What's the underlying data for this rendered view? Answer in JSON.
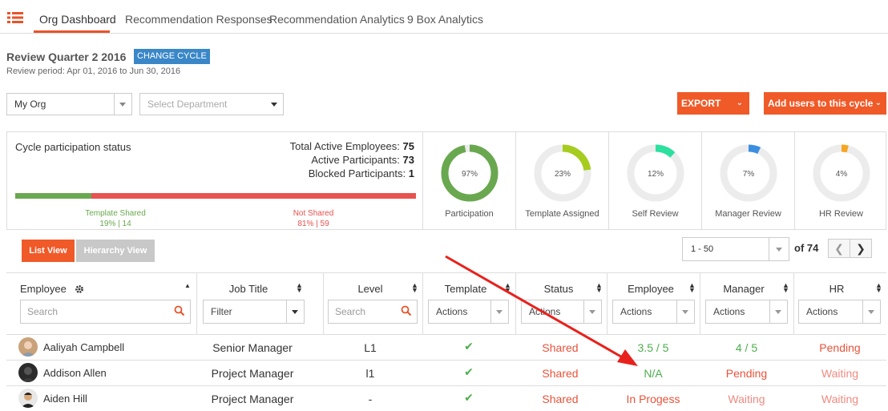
{
  "nav": {
    "tabs": [
      {
        "label": "Org Dashboard"
      },
      {
        "label": "Recommendation Responses"
      },
      {
        "label": "Recommendation Analytics"
      },
      {
        "label": "9 Box Analytics"
      }
    ]
  },
  "cycle": {
    "title": "Review Quarter 2 2016",
    "change_label": "CHANGE CYCLE",
    "period": "Review period: Apr 01, 2016 to Jun 30, 2016"
  },
  "filters": {
    "org": "My Org",
    "department_placeholder": "Select Department"
  },
  "actions": {
    "export_label": "EXPORT",
    "add_users_label": "Add users to this cycle"
  },
  "participation": {
    "title": "Cycle participation status",
    "total_label": "Total Active Employees:",
    "total_value": "75",
    "active_label": "Active Participants:",
    "active_value": "73",
    "blocked_label": "Blocked Participants:",
    "blocked_value": "1",
    "shared_label": "Template Shared",
    "shared_stats": "19% | 14",
    "shared_fraction": 0.19,
    "not_shared_label": "Not Shared",
    "not_shared_stats": "81% | 59",
    "colors": {
      "shared": "#6aa84f",
      "not_shared": "#e8524f"
    }
  },
  "donuts": [
    {
      "label": "Participation",
      "percent_text": "97%",
      "value": 0.97,
      "color": "#6aa84f"
    },
    {
      "label": "Template Assigned",
      "percent_text": "23%",
      "value": 0.23,
      "color": "#a6cc1f"
    },
    {
      "label": "Self Review",
      "percent_text": "12%",
      "value": 0.12,
      "color": "#2ee0a0"
    },
    {
      "label": "Manager Review",
      "percent_text": "7%",
      "value": 0.07,
      "color": "#3c8fe0"
    },
    {
      "label": "HR Review",
      "percent_text": "4%",
      "value": 0.04,
      "color": "#f5a623"
    }
  ],
  "list": {
    "list_view_label": "List View",
    "hierarchy_view_label": "Hierarchy View",
    "page_range": "1 - 50",
    "of_total": "of 74"
  },
  "table": {
    "headers": {
      "employee": "Employee",
      "job_title": "Job Title",
      "level": "Level",
      "template": "Template",
      "status": "Status",
      "employee_review": "Employee",
      "manager": "Manager",
      "hr": "HR"
    },
    "filters": {
      "search_placeholder": "Search",
      "filter_label": "Filter",
      "actions_label": "Actions"
    },
    "rows": [
      {
        "name": "Aaliyah Campbell",
        "job_title": "Senior Manager",
        "level": "L1",
        "status": "Shared",
        "employee": "3.5 / 5",
        "manager": "4 / 5",
        "hr": "Pending"
      },
      {
        "name": "Addison Allen",
        "job_title": "Project Manager",
        "level": "l1",
        "status": "Shared",
        "employee": "N/A",
        "manager": "Pending",
        "hr": "Waiting"
      },
      {
        "name": "Aiden Hill",
        "job_title": "Project Manager",
        "level": "-",
        "status": "Shared",
        "employee": "In Progess",
        "manager": "Waiting",
        "hr": "Waiting"
      }
    ]
  }
}
